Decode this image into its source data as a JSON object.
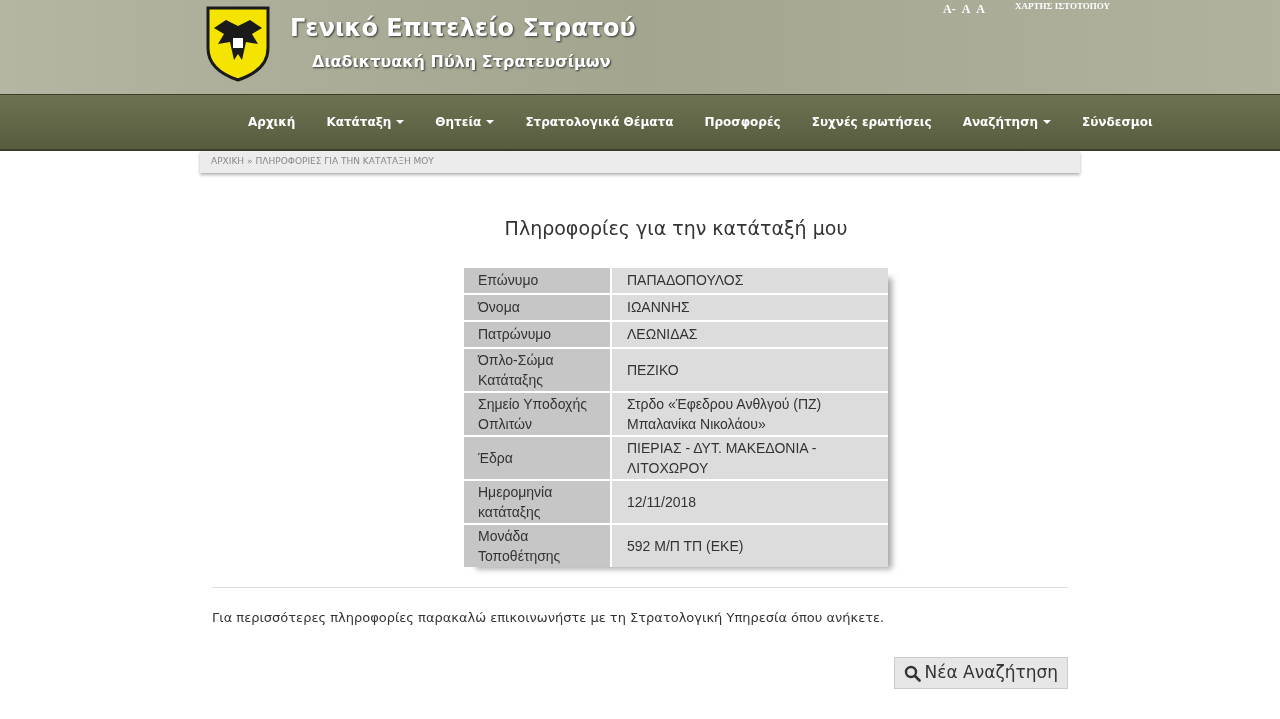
{
  "header": {
    "title": "Γενικό Επιτελείο Στρατού",
    "subtitle": "Διαδικτυακή Πύλη Στρατευσίμων",
    "font_sizes": [
      "Α-",
      "Α",
      "Α"
    ],
    "sitemap": "ΧΑΡΤΗΣ ΙΣΤΟΤΟΠΟΥ"
  },
  "nav": [
    {
      "label": "Αρχική",
      "dropdown": false
    },
    {
      "label": "Κατάταξη",
      "dropdown": true
    },
    {
      "label": "Θητεία",
      "dropdown": true
    },
    {
      "label": "Στρατολογικά Θέματα",
      "dropdown": false
    },
    {
      "label": "Προσφορές",
      "dropdown": false
    },
    {
      "label": "Συχνές ερωτήσεις",
      "dropdown": false
    },
    {
      "label": "Αναζήτηση",
      "dropdown": true
    },
    {
      "label": "Σύνδεσμοι",
      "dropdown": false
    }
  ],
  "breadcrumb": {
    "home": "ΑΡΧΙΚΗ",
    "separator": "»",
    "current": "ΠΛΗΡΟΦΟΡΙΕΣ ΓΙΑ ΤΗΝ ΚΑΤΑΤΑΞΗ ΜΟΥ"
  },
  "heading": "Πληροφορίες για την κατάταξή μου",
  "rows": [
    {
      "label": "Επώνυμο",
      "value": "ΠΑΠΑΔΟΠΟΥΛΟΣ"
    },
    {
      "label": "Όνομα",
      "value": "ΙΩΑΝΝΗΣ"
    },
    {
      "label": "Πατρώνυμο",
      "value": "ΛΕΩΝΙΔΑΣ"
    },
    {
      "label": "Όπλο-Σώμα Κατάταξης",
      "value": "ΠΕΖΙΚΟ"
    },
    {
      "label": "Σημείο Υποδοχής Οπλιτών",
      "value": "Στρδο «Έφεδρου Ανθλγού (ΠΖ) Μπαλανίκα Νικολάου»"
    },
    {
      "label": "Έδρα",
      "value": "ΠΙΕΡΙΑΣ - ΔΥΤ. ΜΑΚΕΔΟΝΙΑ - ΛΙΤΟΧΩΡΟΥ"
    },
    {
      "label": "Ημερομηνία κατάταξης",
      "value": "12/11/2018"
    },
    {
      "label": "Μονάδα Τοποθέτησης",
      "value": "592 Μ/Π ΤΠ (ΕΚΕ)"
    }
  ],
  "note": "Για περισσότερες πληροφορίες παρακαλώ επικοινωνήστε με τη Στρατολογική Υπηρεσία όπου ανήκετε.",
  "new_search_button": "Νέα Αναζήτηση"
}
